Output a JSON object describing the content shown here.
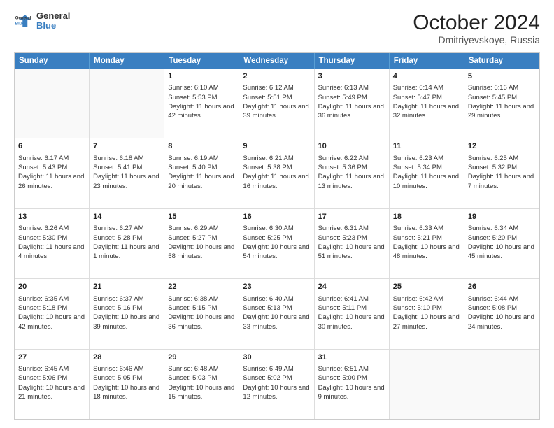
{
  "header": {
    "logo_line1": "General",
    "logo_line2": "Blue",
    "title": "October 2024",
    "subtitle": "Dmitriyevskoye, Russia"
  },
  "calendar": {
    "days_of_week": [
      "Sunday",
      "Monday",
      "Tuesday",
      "Wednesday",
      "Thursday",
      "Friday",
      "Saturday"
    ],
    "rows": [
      [
        {
          "day": "",
          "sunrise": "",
          "sunset": "",
          "daylight": "",
          "empty": true
        },
        {
          "day": "",
          "sunrise": "",
          "sunset": "",
          "daylight": "",
          "empty": true
        },
        {
          "day": "1",
          "sunrise": "Sunrise: 6:10 AM",
          "sunset": "Sunset: 5:53 PM",
          "daylight": "Daylight: 11 hours and 42 minutes.",
          "empty": false
        },
        {
          "day": "2",
          "sunrise": "Sunrise: 6:12 AM",
          "sunset": "Sunset: 5:51 PM",
          "daylight": "Daylight: 11 hours and 39 minutes.",
          "empty": false
        },
        {
          "day": "3",
          "sunrise": "Sunrise: 6:13 AM",
          "sunset": "Sunset: 5:49 PM",
          "daylight": "Daylight: 11 hours and 36 minutes.",
          "empty": false
        },
        {
          "day": "4",
          "sunrise": "Sunrise: 6:14 AM",
          "sunset": "Sunset: 5:47 PM",
          "daylight": "Daylight: 11 hours and 32 minutes.",
          "empty": false
        },
        {
          "day": "5",
          "sunrise": "Sunrise: 6:16 AM",
          "sunset": "Sunset: 5:45 PM",
          "daylight": "Daylight: 11 hours and 29 minutes.",
          "empty": false
        }
      ],
      [
        {
          "day": "6",
          "sunrise": "Sunrise: 6:17 AM",
          "sunset": "Sunset: 5:43 PM",
          "daylight": "Daylight: 11 hours and 26 minutes.",
          "empty": false
        },
        {
          "day": "7",
          "sunrise": "Sunrise: 6:18 AM",
          "sunset": "Sunset: 5:41 PM",
          "daylight": "Daylight: 11 hours and 23 minutes.",
          "empty": false
        },
        {
          "day": "8",
          "sunrise": "Sunrise: 6:19 AM",
          "sunset": "Sunset: 5:40 PM",
          "daylight": "Daylight: 11 hours and 20 minutes.",
          "empty": false
        },
        {
          "day": "9",
          "sunrise": "Sunrise: 6:21 AM",
          "sunset": "Sunset: 5:38 PM",
          "daylight": "Daylight: 11 hours and 16 minutes.",
          "empty": false
        },
        {
          "day": "10",
          "sunrise": "Sunrise: 6:22 AM",
          "sunset": "Sunset: 5:36 PM",
          "daylight": "Daylight: 11 hours and 13 minutes.",
          "empty": false
        },
        {
          "day": "11",
          "sunrise": "Sunrise: 6:23 AM",
          "sunset": "Sunset: 5:34 PM",
          "daylight": "Daylight: 11 hours and 10 minutes.",
          "empty": false
        },
        {
          "day": "12",
          "sunrise": "Sunrise: 6:25 AM",
          "sunset": "Sunset: 5:32 PM",
          "daylight": "Daylight: 11 hours and 7 minutes.",
          "empty": false
        }
      ],
      [
        {
          "day": "13",
          "sunrise": "Sunrise: 6:26 AM",
          "sunset": "Sunset: 5:30 PM",
          "daylight": "Daylight: 11 hours and 4 minutes.",
          "empty": false
        },
        {
          "day": "14",
          "sunrise": "Sunrise: 6:27 AM",
          "sunset": "Sunset: 5:28 PM",
          "daylight": "Daylight: 11 hours and 1 minute.",
          "empty": false
        },
        {
          "day": "15",
          "sunrise": "Sunrise: 6:29 AM",
          "sunset": "Sunset: 5:27 PM",
          "daylight": "Daylight: 10 hours and 58 minutes.",
          "empty": false
        },
        {
          "day": "16",
          "sunrise": "Sunrise: 6:30 AM",
          "sunset": "Sunset: 5:25 PM",
          "daylight": "Daylight: 10 hours and 54 minutes.",
          "empty": false
        },
        {
          "day": "17",
          "sunrise": "Sunrise: 6:31 AM",
          "sunset": "Sunset: 5:23 PM",
          "daylight": "Daylight: 10 hours and 51 minutes.",
          "empty": false
        },
        {
          "day": "18",
          "sunrise": "Sunrise: 6:33 AM",
          "sunset": "Sunset: 5:21 PM",
          "daylight": "Daylight: 10 hours and 48 minutes.",
          "empty": false
        },
        {
          "day": "19",
          "sunrise": "Sunrise: 6:34 AM",
          "sunset": "Sunset: 5:20 PM",
          "daylight": "Daylight: 10 hours and 45 minutes.",
          "empty": false
        }
      ],
      [
        {
          "day": "20",
          "sunrise": "Sunrise: 6:35 AM",
          "sunset": "Sunset: 5:18 PM",
          "daylight": "Daylight: 10 hours and 42 minutes.",
          "empty": false
        },
        {
          "day": "21",
          "sunrise": "Sunrise: 6:37 AM",
          "sunset": "Sunset: 5:16 PM",
          "daylight": "Daylight: 10 hours and 39 minutes.",
          "empty": false
        },
        {
          "day": "22",
          "sunrise": "Sunrise: 6:38 AM",
          "sunset": "Sunset: 5:15 PM",
          "daylight": "Daylight: 10 hours and 36 minutes.",
          "empty": false
        },
        {
          "day": "23",
          "sunrise": "Sunrise: 6:40 AM",
          "sunset": "Sunset: 5:13 PM",
          "daylight": "Daylight: 10 hours and 33 minutes.",
          "empty": false
        },
        {
          "day": "24",
          "sunrise": "Sunrise: 6:41 AM",
          "sunset": "Sunset: 5:11 PM",
          "daylight": "Daylight: 10 hours and 30 minutes.",
          "empty": false
        },
        {
          "day": "25",
          "sunrise": "Sunrise: 6:42 AM",
          "sunset": "Sunset: 5:10 PM",
          "daylight": "Daylight: 10 hours and 27 minutes.",
          "empty": false
        },
        {
          "day": "26",
          "sunrise": "Sunrise: 6:44 AM",
          "sunset": "Sunset: 5:08 PM",
          "daylight": "Daylight: 10 hours and 24 minutes.",
          "empty": false
        }
      ],
      [
        {
          "day": "27",
          "sunrise": "Sunrise: 6:45 AM",
          "sunset": "Sunset: 5:06 PM",
          "daylight": "Daylight: 10 hours and 21 minutes.",
          "empty": false
        },
        {
          "day": "28",
          "sunrise": "Sunrise: 6:46 AM",
          "sunset": "Sunset: 5:05 PM",
          "daylight": "Daylight: 10 hours and 18 minutes.",
          "empty": false
        },
        {
          "day": "29",
          "sunrise": "Sunrise: 6:48 AM",
          "sunset": "Sunset: 5:03 PM",
          "daylight": "Daylight: 10 hours and 15 minutes.",
          "empty": false
        },
        {
          "day": "30",
          "sunrise": "Sunrise: 6:49 AM",
          "sunset": "Sunset: 5:02 PM",
          "daylight": "Daylight: 10 hours and 12 minutes.",
          "empty": false
        },
        {
          "day": "31",
          "sunrise": "Sunrise: 6:51 AM",
          "sunset": "Sunset: 5:00 PM",
          "daylight": "Daylight: 10 hours and 9 minutes.",
          "empty": false
        },
        {
          "day": "",
          "sunrise": "",
          "sunset": "",
          "daylight": "",
          "empty": true
        },
        {
          "day": "",
          "sunrise": "",
          "sunset": "",
          "daylight": "",
          "empty": true
        }
      ]
    ]
  }
}
